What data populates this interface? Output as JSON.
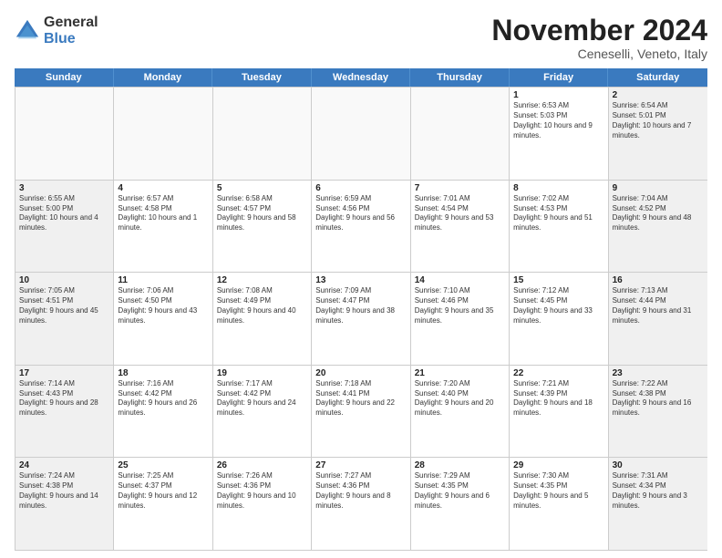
{
  "logo": {
    "general": "General",
    "blue": "Blue"
  },
  "title": "November 2024",
  "location": "Ceneselli, Veneto, Italy",
  "header_days": [
    "Sunday",
    "Monday",
    "Tuesday",
    "Wednesday",
    "Thursday",
    "Friday",
    "Saturday"
  ],
  "weeks": [
    [
      {
        "day": "",
        "info": "",
        "empty": true
      },
      {
        "day": "",
        "info": "",
        "empty": true
      },
      {
        "day": "",
        "info": "",
        "empty": true
      },
      {
        "day": "",
        "info": "",
        "empty": true
      },
      {
        "day": "",
        "info": "",
        "empty": true
      },
      {
        "day": "1",
        "info": "Sunrise: 6:53 AM\nSunset: 5:03 PM\nDaylight: 10 hours and 9 minutes.",
        "empty": false
      },
      {
        "day": "2",
        "info": "Sunrise: 6:54 AM\nSunset: 5:01 PM\nDaylight: 10 hours and 7 minutes.",
        "empty": false
      }
    ],
    [
      {
        "day": "3",
        "info": "Sunrise: 6:55 AM\nSunset: 5:00 PM\nDaylight: 10 hours and 4 minutes.",
        "empty": false
      },
      {
        "day": "4",
        "info": "Sunrise: 6:57 AM\nSunset: 4:58 PM\nDaylight: 10 hours and 1 minute.",
        "empty": false
      },
      {
        "day": "5",
        "info": "Sunrise: 6:58 AM\nSunset: 4:57 PM\nDaylight: 9 hours and 58 minutes.",
        "empty": false
      },
      {
        "day": "6",
        "info": "Sunrise: 6:59 AM\nSunset: 4:56 PM\nDaylight: 9 hours and 56 minutes.",
        "empty": false
      },
      {
        "day": "7",
        "info": "Sunrise: 7:01 AM\nSunset: 4:54 PM\nDaylight: 9 hours and 53 minutes.",
        "empty": false
      },
      {
        "day": "8",
        "info": "Sunrise: 7:02 AM\nSunset: 4:53 PM\nDaylight: 9 hours and 51 minutes.",
        "empty": false
      },
      {
        "day": "9",
        "info": "Sunrise: 7:04 AM\nSunset: 4:52 PM\nDaylight: 9 hours and 48 minutes.",
        "empty": false
      }
    ],
    [
      {
        "day": "10",
        "info": "Sunrise: 7:05 AM\nSunset: 4:51 PM\nDaylight: 9 hours and 45 minutes.",
        "empty": false
      },
      {
        "day": "11",
        "info": "Sunrise: 7:06 AM\nSunset: 4:50 PM\nDaylight: 9 hours and 43 minutes.",
        "empty": false
      },
      {
        "day": "12",
        "info": "Sunrise: 7:08 AM\nSunset: 4:49 PM\nDaylight: 9 hours and 40 minutes.",
        "empty": false
      },
      {
        "day": "13",
        "info": "Sunrise: 7:09 AM\nSunset: 4:47 PM\nDaylight: 9 hours and 38 minutes.",
        "empty": false
      },
      {
        "day": "14",
        "info": "Sunrise: 7:10 AM\nSunset: 4:46 PM\nDaylight: 9 hours and 35 minutes.",
        "empty": false
      },
      {
        "day": "15",
        "info": "Sunrise: 7:12 AM\nSunset: 4:45 PM\nDaylight: 9 hours and 33 minutes.",
        "empty": false
      },
      {
        "day": "16",
        "info": "Sunrise: 7:13 AM\nSunset: 4:44 PM\nDaylight: 9 hours and 31 minutes.",
        "empty": false
      }
    ],
    [
      {
        "day": "17",
        "info": "Sunrise: 7:14 AM\nSunset: 4:43 PM\nDaylight: 9 hours and 28 minutes.",
        "empty": false
      },
      {
        "day": "18",
        "info": "Sunrise: 7:16 AM\nSunset: 4:42 PM\nDaylight: 9 hours and 26 minutes.",
        "empty": false
      },
      {
        "day": "19",
        "info": "Sunrise: 7:17 AM\nSunset: 4:42 PM\nDaylight: 9 hours and 24 minutes.",
        "empty": false
      },
      {
        "day": "20",
        "info": "Sunrise: 7:18 AM\nSunset: 4:41 PM\nDaylight: 9 hours and 22 minutes.",
        "empty": false
      },
      {
        "day": "21",
        "info": "Sunrise: 7:20 AM\nSunset: 4:40 PM\nDaylight: 9 hours and 20 minutes.",
        "empty": false
      },
      {
        "day": "22",
        "info": "Sunrise: 7:21 AM\nSunset: 4:39 PM\nDaylight: 9 hours and 18 minutes.",
        "empty": false
      },
      {
        "day": "23",
        "info": "Sunrise: 7:22 AM\nSunset: 4:38 PM\nDaylight: 9 hours and 16 minutes.",
        "empty": false
      }
    ],
    [
      {
        "day": "24",
        "info": "Sunrise: 7:24 AM\nSunset: 4:38 PM\nDaylight: 9 hours and 14 minutes.",
        "empty": false
      },
      {
        "day": "25",
        "info": "Sunrise: 7:25 AM\nSunset: 4:37 PM\nDaylight: 9 hours and 12 minutes.",
        "empty": false
      },
      {
        "day": "26",
        "info": "Sunrise: 7:26 AM\nSunset: 4:36 PM\nDaylight: 9 hours and 10 minutes.",
        "empty": false
      },
      {
        "day": "27",
        "info": "Sunrise: 7:27 AM\nSunset: 4:36 PM\nDaylight: 9 hours and 8 minutes.",
        "empty": false
      },
      {
        "day": "28",
        "info": "Sunrise: 7:29 AM\nSunset: 4:35 PM\nDaylight: 9 hours and 6 minutes.",
        "empty": false
      },
      {
        "day": "29",
        "info": "Sunrise: 7:30 AM\nSunset: 4:35 PM\nDaylight: 9 hours and 5 minutes.",
        "empty": false
      },
      {
        "day": "30",
        "info": "Sunrise: 7:31 AM\nSunset: 4:34 PM\nDaylight: 9 hours and 3 minutes.",
        "empty": false
      }
    ]
  ]
}
